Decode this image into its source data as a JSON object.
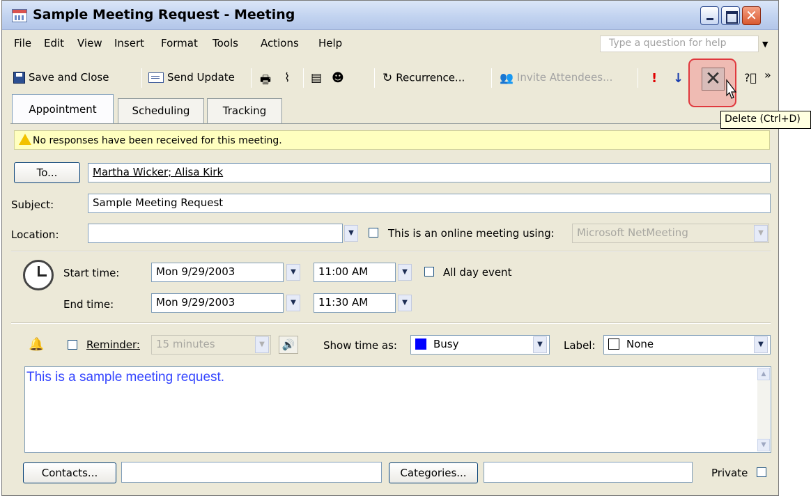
{
  "window": {
    "title": "Sample Meeting Request - Meeting"
  },
  "menu": [
    "File",
    "Edit",
    "View",
    "Insert",
    "Format",
    "Tools",
    "Actions",
    "Help"
  ],
  "help_placeholder": "Type a question for help",
  "toolbar": {
    "save_close": "Save and Close",
    "send_update": "Send Update",
    "recurrence": "Recurrence...",
    "invite": "Invite Attendees...",
    "more": "»"
  },
  "tooltip": "Delete (Ctrl+D)",
  "tabs": [
    "Appointment",
    "Scheduling",
    "Tracking"
  ],
  "infobar": "No responses have been received for this meeting.",
  "to": {
    "button": "To...",
    "value": "Martha Wicker; Alisa Kirk"
  },
  "subject": {
    "label": "Subject:",
    "value": "Sample Meeting Request"
  },
  "location": {
    "label": "Location:",
    "value": ""
  },
  "online": {
    "label": "This is an online meeting using:",
    "value": "Microsoft NetMeeting"
  },
  "start": {
    "label": "Start time:",
    "date": "Mon 9/29/2003",
    "time": "11:00 AM"
  },
  "end": {
    "label": "End time:",
    "date": "Mon 9/29/2003",
    "time": "11:30 AM"
  },
  "allday": "All day event",
  "reminder": {
    "label": "Reminder:",
    "value": "15 minutes"
  },
  "showtime": {
    "label": "Show time as:",
    "value": "Busy",
    "color": "#0000ff"
  },
  "label": {
    "label": "Label:",
    "value": "None"
  },
  "body": "This is a sample meeting request.",
  "contacts": {
    "button": "Contacts...",
    "value": ""
  },
  "categories": {
    "button": "Categories...",
    "value": ""
  },
  "private": "Private"
}
